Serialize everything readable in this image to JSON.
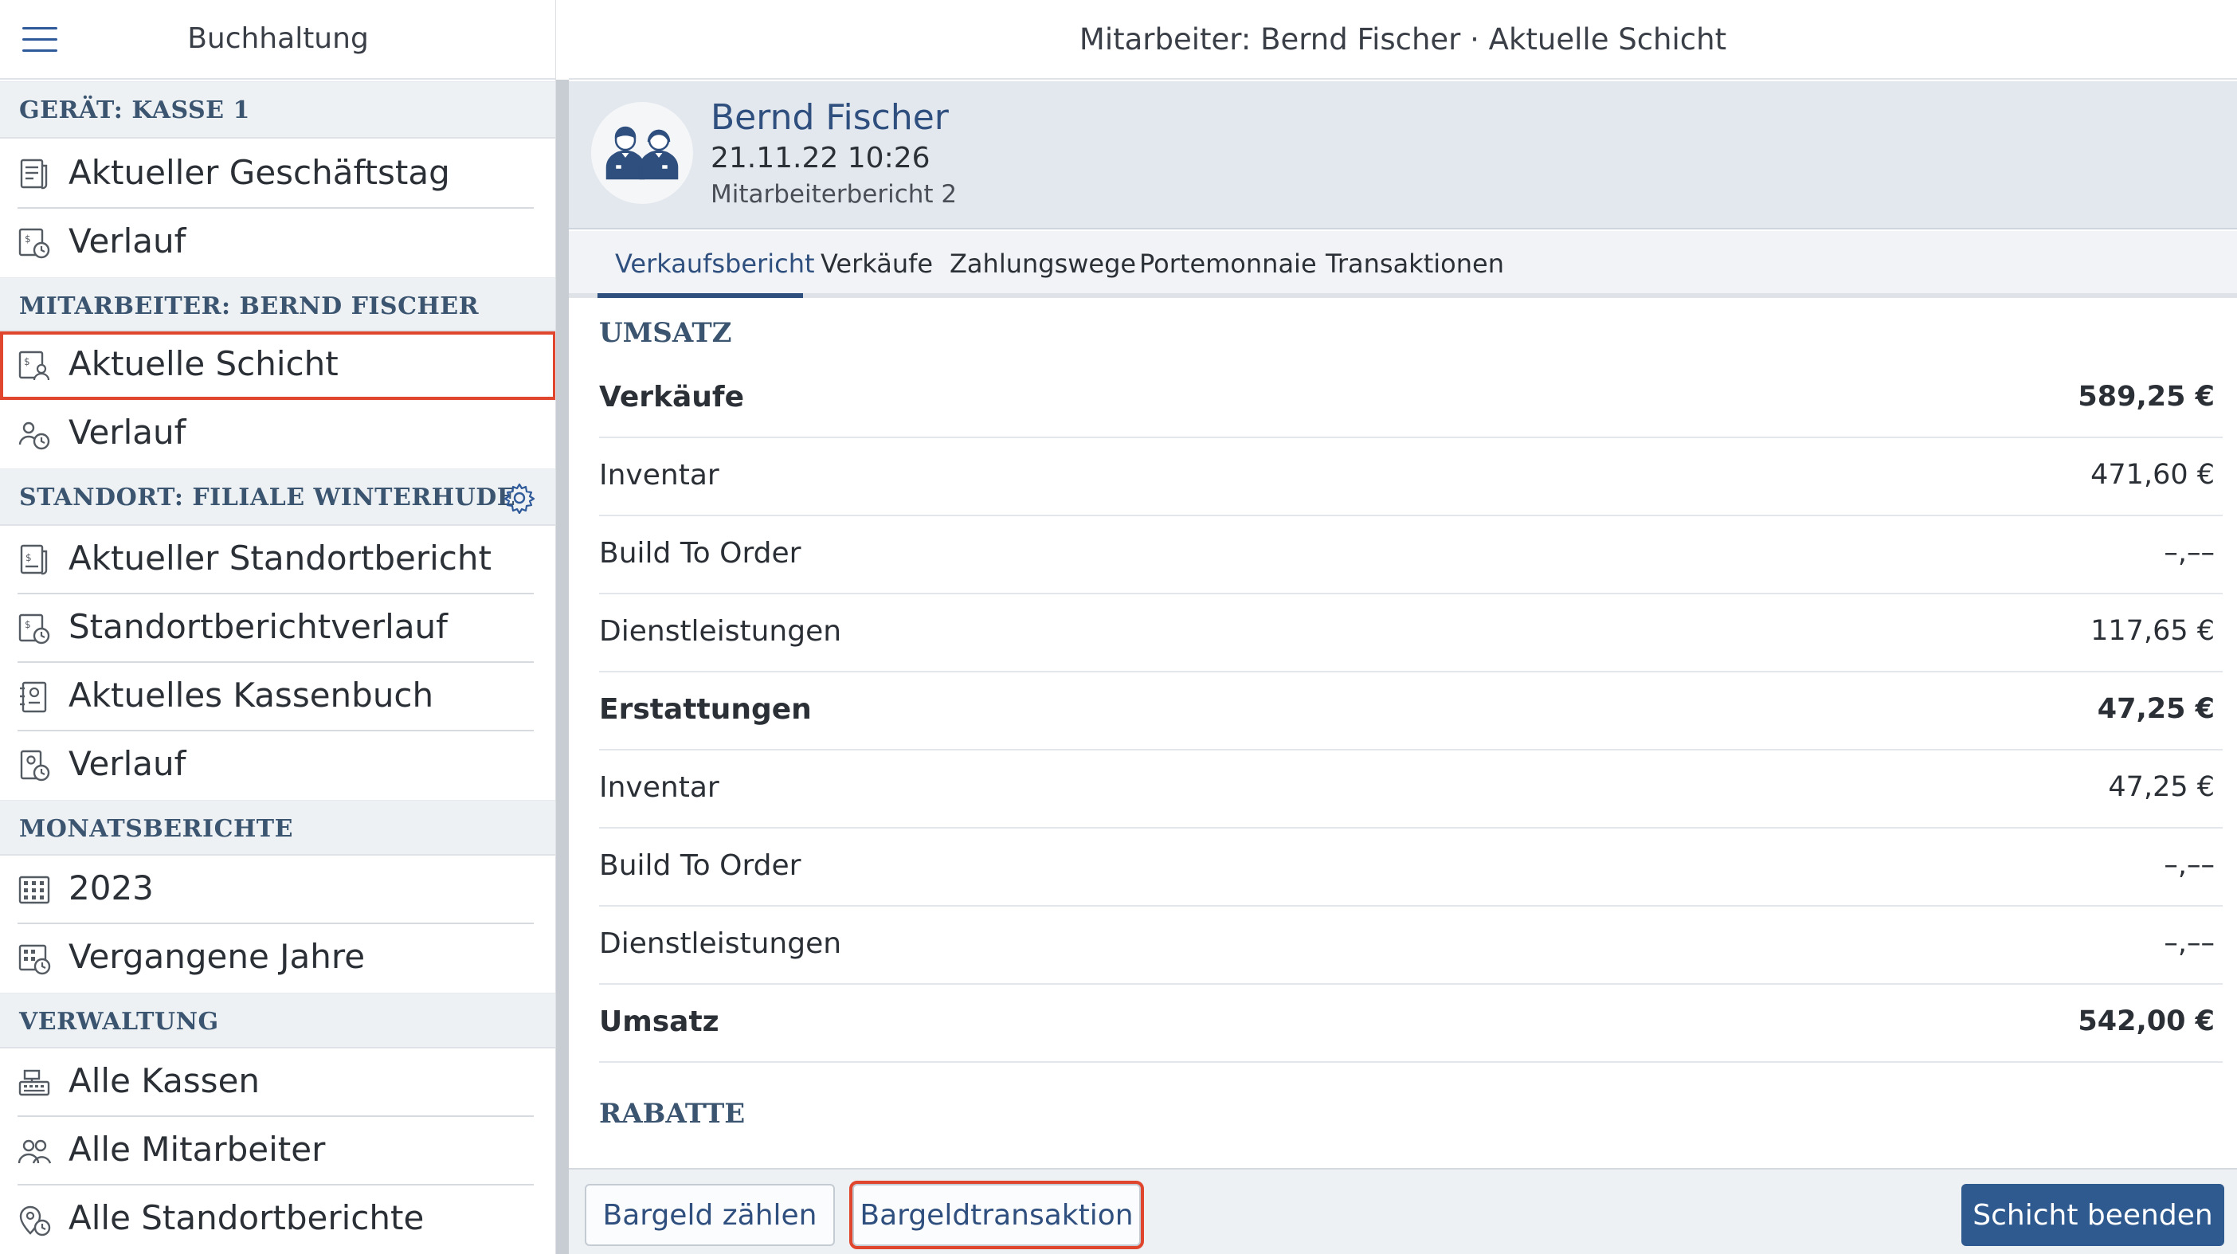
{
  "sidebar": {
    "title": "Buchhaltung",
    "sections": [
      {
        "header": "GERÄT: KASSE 1",
        "items": [
          {
            "label": "Aktueller Geschäftstag",
            "icon": "receipt-icon"
          },
          {
            "label": "Verlauf",
            "icon": "history-icon"
          }
        ]
      },
      {
        "header": "MITARBEITER: BERND FISCHER",
        "items": [
          {
            "label": "Aktuelle Schicht",
            "icon": "shift-report-icon",
            "selected": true
          },
          {
            "label": "Verlauf",
            "icon": "history-icon"
          }
        ]
      },
      {
        "header": "STANDORT: FILIALE WINTERHUDE",
        "has_settings": true,
        "items": [
          {
            "label": "Aktueller Standortbericht",
            "icon": "receipt-icon"
          },
          {
            "label": "Standortberichtverlauf",
            "icon": "history-icon"
          },
          {
            "label": "Aktuelles Kassenbuch",
            "icon": "cashbook-icon"
          },
          {
            "label": "Verlauf",
            "icon": "history-icon"
          }
        ]
      },
      {
        "header": "MONATSBERICHTE",
        "items": [
          {
            "label": "2023",
            "icon": "calendar-icon"
          },
          {
            "label": "Vergangene Jahre",
            "icon": "calendar-history-icon"
          }
        ]
      },
      {
        "header": "VERWALTUNG",
        "items": [
          {
            "label": "Alle Kassen",
            "icon": "cash-register-icon"
          },
          {
            "label": "Alle Mitarbeiter",
            "icon": "people-icon"
          },
          {
            "label": "Alle Standortberichte",
            "icon": "location-report-icon"
          }
        ]
      }
    ]
  },
  "main": {
    "title": "Mitarbeiter: Bernd Fischer · Aktuelle Schicht",
    "profile": {
      "name": "Bernd Fischer",
      "datetime": "21.11.22 10:26",
      "report": "Mitarbeiterbericht 2"
    },
    "tabs": [
      "Verkaufsbericht",
      "Verkäufe",
      "Zahlungswege",
      "Portemonnaie",
      "Transaktionen"
    ],
    "active_tab": "Verkaufsbericht",
    "report": {
      "section_revenue": "UMSATZ",
      "rows": [
        {
          "label": "Verkäufe",
          "value": "589,25 €",
          "bold": true
        },
        {
          "label": "Inventar",
          "value": "471,60 €",
          "bold": false
        },
        {
          "label": "Build To Order",
          "value": "–,––",
          "bold": false
        },
        {
          "label": "Dienstleistungen",
          "value": "117,65 €",
          "bold": false
        },
        {
          "label": "Erstattungen",
          "value": "47,25 €",
          "bold": true
        },
        {
          "label": "Inventar",
          "value": "47,25 €",
          "bold": false
        },
        {
          "label": "Build To Order",
          "value": "–,––",
          "bold": false
        },
        {
          "label": "Dienstleistungen",
          "value": "–,––",
          "bold": false
        },
        {
          "label": "Umsatz",
          "value": "542,00 €",
          "bold": true
        }
      ],
      "section_discounts": "RABATTE"
    },
    "buttons": {
      "count_cash": "Bargeld zählen",
      "cash_transaction": "Bargeldtransaktion",
      "end_shift": "Schicht beenden"
    }
  },
  "colors": {
    "accent": "#2f4f7f",
    "primary_button": "#2f5a8f",
    "highlight": "#e0462e",
    "section_bg": "#eef1f4"
  }
}
